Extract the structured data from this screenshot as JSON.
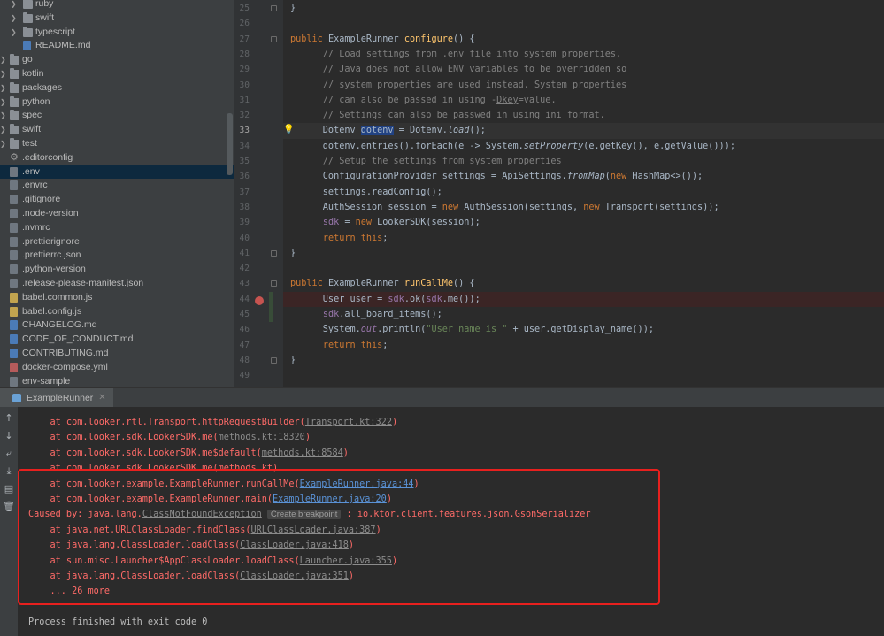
{
  "tree": {
    "items": [
      {
        "label": "ruby",
        "type": "folder",
        "indent": 2,
        "arrow": true
      },
      {
        "label": "swift",
        "type": "folder",
        "indent": 2,
        "arrow": true
      },
      {
        "label": "typescript",
        "type": "folder",
        "indent": 2,
        "arrow": true
      },
      {
        "label": "README.md",
        "type": "file",
        "color": "blue",
        "indent": 2
      },
      {
        "label": "go",
        "type": "folder",
        "indent": 1,
        "arrow": true
      },
      {
        "label": "kotlin",
        "type": "folder",
        "indent": 1,
        "arrow": true
      },
      {
        "label": "packages",
        "type": "folder",
        "indent": 1,
        "arrow": true
      },
      {
        "label": "python",
        "type": "folder",
        "indent": 1,
        "arrow": true
      },
      {
        "label": "spec",
        "type": "folder",
        "indent": 1,
        "arrow": true
      },
      {
        "label": "swift",
        "type": "folder",
        "indent": 1,
        "arrow": true
      },
      {
        "label": "test",
        "type": "folder",
        "indent": 1,
        "arrow": true
      },
      {
        "label": ".editorconfig",
        "type": "gear",
        "indent": 1
      },
      {
        "label": ".env",
        "type": "file",
        "indent": 1,
        "selected": true
      },
      {
        "label": ".envrc",
        "type": "file",
        "indent": 1
      },
      {
        "label": ".gitignore",
        "type": "file",
        "indent": 1
      },
      {
        "label": ".node-version",
        "type": "file",
        "indent": 1
      },
      {
        "label": ".nvmrc",
        "type": "file",
        "indent": 1
      },
      {
        "label": ".prettierignore",
        "type": "file",
        "indent": 1
      },
      {
        "label": ".prettierrc.json",
        "type": "file",
        "indent": 1
      },
      {
        "label": ".python-version",
        "type": "file",
        "indent": 1
      },
      {
        "label": ".release-please-manifest.json",
        "type": "file",
        "indent": 1
      },
      {
        "label": "babel.common.js",
        "type": "file",
        "color": "yellow",
        "indent": 1
      },
      {
        "label": "babel.config.js",
        "type": "file",
        "color": "yellow",
        "indent": 1
      },
      {
        "label": "CHANGELOG.md",
        "type": "file",
        "color": "blue",
        "indent": 1
      },
      {
        "label": "CODE_OF_CONDUCT.md",
        "type": "file",
        "color": "blue",
        "indent": 1
      },
      {
        "label": "CONTRIBUTING.md",
        "type": "file",
        "color": "blue",
        "indent": 1
      },
      {
        "label": "docker-compose.yml",
        "type": "file",
        "color": "red",
        "indent": 1
      },
      {
        "label": "env-sample",
        "type": "file",
        "indent": 1
      }
    ]
  },
  "editor": {
    "lines": [
      {
        "n": "25",
        "html": "}"
      },
      {
        "n": "26",
        "html": ""
      },
      {
        "n": "27",
        "html": "<span class='kw'>public</span> ExampleRunner <span class='fn'>configure</span>() {"
      },
      {
        "n": "28",
        "html": "  <span class='cm'>// Load settings from .env file into system properties.</span>"
      },
      {
        "n": "29",
        "html": "  <span class='cm'>// Java does not allow ENV variables to be overridden so</span>"
      },
      {
        "n": "30",
        "html": "  <span class='cm'>// system properties are used instead. System properties</span>"
      },
      {
        "n": "31",
        "html": "  <span class='cm'>// can also be passed in using -<span class='ul'>Dkey</span>=value.</span>"
      },
      {
        "n": "32",
        "html": "  <span class='cm'>// Settings can also be <span class='ul'>passwed</span> in using ini format.</span>"
      },
      {
        "n": "33",
        "html": "  Dotenv <span class='sel'>dotenv</span> = Dotenv.<span class='it'>load</span>();",
        "current": true
      },
      {
        "n": "34",
        "html": "  dotenv.entries().forEach(e -&gt; System.<span class='it'>setProperty</span>(e.getKey(), e.getValue()));"
      },
      {
        "n": "35",
        "html": "  <span class='cm'>// <span class='ul'>Setup</span> the settings from system properties</span>"
      },
      {
        "n": "36",
        "html": "  ConfigurationProvider settings = ApiSettings.<span class='it'>fromMap</span>(<span class='kw'>new</span> HashMap&lt;&gt;());"
      },
      {
        "n": "37",
        "html": "  settings.readConfig();"
      },
      {
        "n": "38",
        "html": "  AuthSession session = <span class='kw'>new</span> AuthSession(settings, <span class='kw'>new</span> Transport(settings));"
      },
      {
        "n": "39",
        "html": "  <span class='sv'>sdk</span> = <span class='kw'>new</span> LookerSDK(session);"
      },
      {
        "n": "40",
        "html": "  <span class='kw'>return this</span>;"
      },
      {
        "n": "41",
        "html": "}"
      },
      {
        "n": "42",
        "html": ""
      },
      {
        "n": "43",
        "html": "<span class='kw'>public</span> ExampleRunner <span class='fn ul'>runCallMe</span>() {"
      },
      {
        "n": "44",
        "html": "  User user = <span class='sv'>sdk</span>.ok(<span class='sv'>sdk</span>.me());",
        "breakpoint": true
      },
      {
        "n": "45",
        "html": "  <span class='sv'>sdk</span>.all_board_items();"
      },
      {
        "n": "46",
        "html": "  System.<span class='sv it'>out</span>.println(<span class='st'>\"User name is \"</span> + user.getDisplay_name());"
      },
      {
        "n": "47",
        "html": "  <span class='kw'>return this</span>;"
      },
      {
        "n": "48",
        "html": "}"
      },
      {
        "n": "49",
        "html": ""
      }
    ]
  },
  "run": {
    "tab_label": "ExampleRunner",
    "lines": [
      {
        "html": "    at com.looker.rtl.Transport.httpRequestBuilder(<span class='lnk-gray'>Transport.kt:322</span>)"
      },
      {
        "html": "    at com.looker.sdk.LookerSDK.me(<span class='lnk-gray'>methods.kt:18320</span>)"
      },
      {
        "html": "    at com.looker.sdk.LookerSDK.me$default(<span class='lnk-gray'>methods.kt:8584</span>)"
      },
      {
        "html": "    at com.looker.sdk.LookerSDK.me(methods.kt)"
      },
      {
        "html": "    at com.looker.example.ExampleRunner.runCallMe(<span class='link'>ExampleRunner.java:44</span>)"
      },
      {
        "html": "    at com.looker.example.ExampleRunner.main(<span class='link'>ExampleRunner.java:20</span>)"
      },
      {
        "html": "Caused by: java.lang.<span class='lnk-gray'>ClassNotFoundException</span> <span class='tip'>Create breakpoint</span> : io.ktor.client.features.json.GsonSerializer"
      },
      {
        "html": "    at java.net.URLClassLoader.findClass(<span class='lnk-gray'>URLClassLoader.java:387</span>)"
      },
      {
        "html": "    at java.lang.ClassLoader.loadClass(<span class='lnk-gray'>ClassLoader.java:418</span>)"
      },
      {
        "html": "    at sun.misc.Launcher$AppClassLoader.loadClass(<span class='lnk-gray'>Launcher.java:355</span>)"
      },
      {
        "html": "    at java.lang.ClassLoader.loadClass(<span class='lnk-gray'>ClassLoader.java:351</span>)"
      },
      {
        "html": "    ... 26 more"
      },
      {
        "html": ""
      },
      {
        "html": "<span class='plain'>Process finished with exit code 0</span>"
      }
    ]
  }
}
